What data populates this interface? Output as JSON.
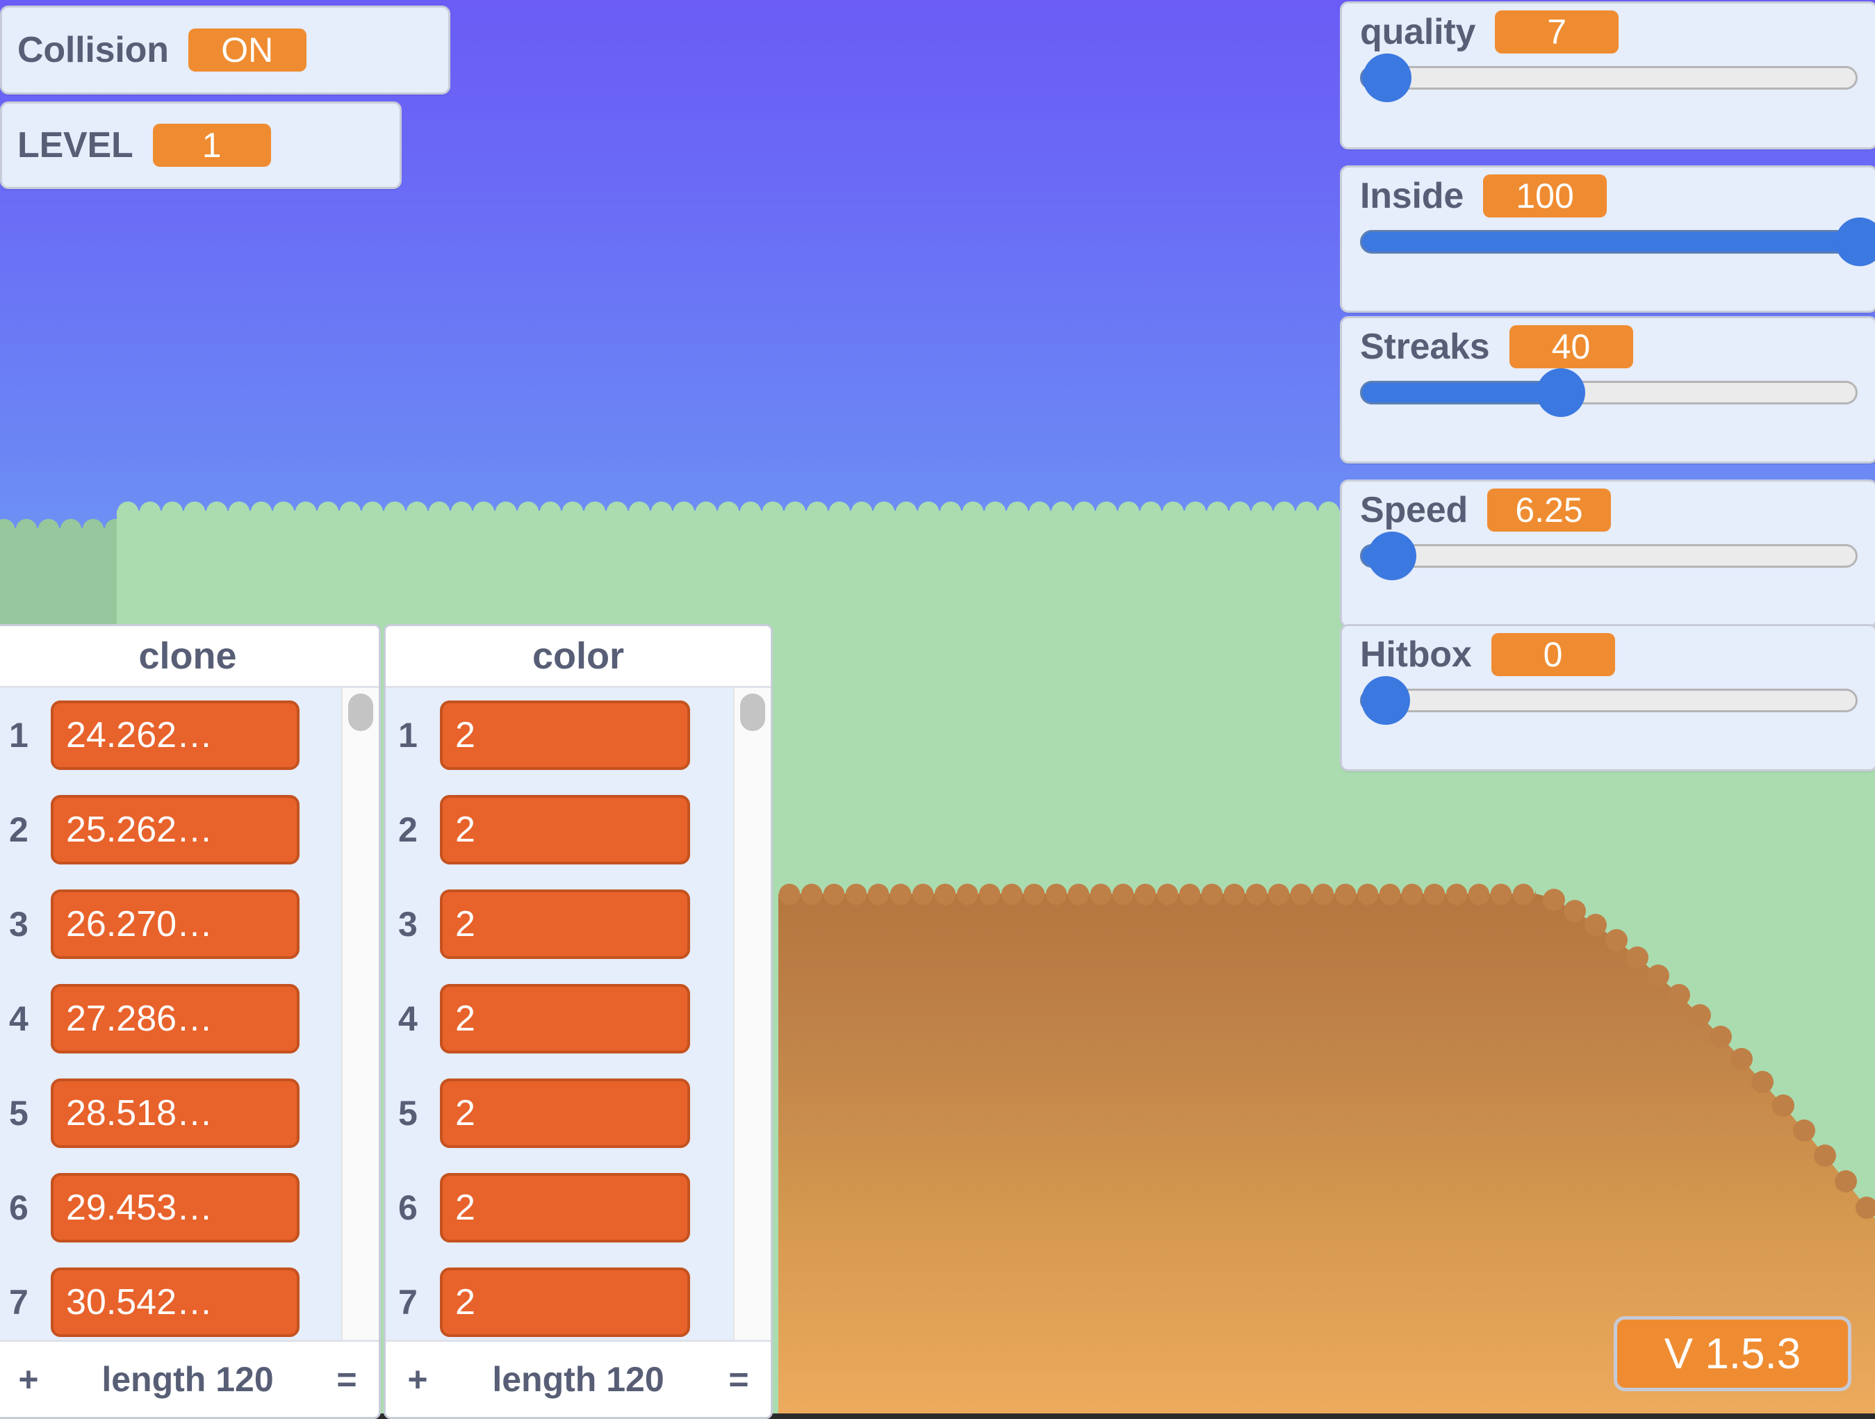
{
  "scene": {
    "sky_top_color": "#6a5cf5",
    "sky_horizon_color": "#8ceaf9",
    "grass_color": "#aadcb0",
    "far_hill_color": "#97c79c",
    "dirt_top_color": "#b5763f",
    "dirt_bottom_color": "#eeab5e"
  },
  "readouts": [
    {
      "label": "Collision",
      "value": "ON"
    },
    {
      "label": "LEVEL",
      "value": "1"
    }
  ],
  "sliders": [
    {
      "label": "quality",
      "value": "7",
      "percent": 5
    },
    {
      "label": "Inside",
      "value": "100",
      "percent": 100
    },
    {
      "label": "Streaks",
      "value": "40",
      "percent": 40
    },
    {
      "label": "Speed",
      "value": "6.25",
      "percent": 6
    },
    {
      "label": "Hitbox",
      "value": "0",
      "percent": 0
    }
  ],
  "lists": [
    {
      "title": "clone",
      "rows": [
        {
          "index": "1",
          "value": "24.262…"
        },
        {
          "index": "2",
          "value": "25.262…"
        },
        {
          "index": "3",
          "value": "26.270…"
        },
        {
          "index": "4",
          "value": "27.286…"
        },
        {
          "index": "5",
          "value": "28.518…"
        },
        {
          "index": "6",
          "value": "29.453…"
        },
        {
          "index": "7",
          "value": "30.542…"
        }
      ],
      "footer": {
        "add": "+",
        "length": "length 120",
        "resize": "="
      }
    },
    {
      "title": "color",
      "rows": [
        {
          "index": "1",
          "value": "2"
        },
        {
          "index": "2",
          "value": "2"
        },
        {
          "index": "3",
          "value": "2"
        },
        {
          "index": "4",
          "value": "2"
        },
        {
          "index": "5",
          "value": "2"
        },
        {
          "index": "6",
          "value": "2"
        },
        {
          "index": "7",
          "value": "2"
        }
      ],
      "footer": {
        "add": "+",
        "length": "length 120",
        "resize": "="
      }
    }
  ],
  "version_badge": {
    "label": "V 1.5.3",
    "background": "#ef8c31"
  },
  "colors": {
    "monitor_bg": "#e6edfb",
    "monitor_border": "#c8ccd8",
    "value_orange": "#ef8c31",
    "cell_orange": "#e8622b",
    "slider_blue": "#3b78e0",
    "text_slate": "#575e75"
  }
}
